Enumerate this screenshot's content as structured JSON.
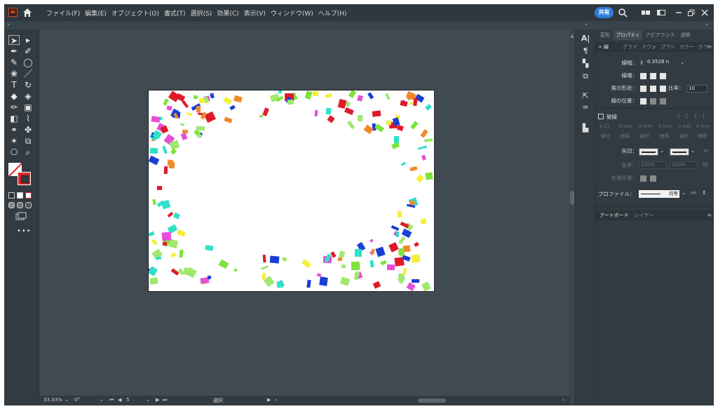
{
  "menubar": {
    "logo": "Ai",
    "items": [
      "ファイル(F)",
      "編集(E)",
      "オブジェクト(O)",
      "書式(T)",
      "選択(S)",
      "効果(C)",
      "表示(V)",
      "ウィンドウ(W)",
      "ヘルプ(H)"
    ],
    "share_label": "共有",
    "icons": [
      "home-icon",
      "search-icon",
      "arrange-icon",
      "panel-icon",
      "minimize-icon",
      "restore-icon",
      "close-icon"
    ]
  },
  "statusbar": {
    "zoom": "33.33%",
    "rotation": "0°",
    "artboard_number": "5",
    "mode": "選択"
  },
  "panel": {
    "tabs": [
      "変形",
      "プロパティ",
      "アピアランス",
      "透明"
    ],
    "active_tab": "プロパティ",
    "subtabs": [
      "線",
      "グラデ",
      "スウォ",
      "ブラシ",
      "カラー",
      "カラー"
    ],
    "stroke_weight_label": "線幅：",
    "stroke_weight_value": "0.3528 n",
    "cap_label": "線端：",
    "corner_label": "角の形状：",
    "ratio_label": "比率：",
    "ratio_value": "10",
    "align_label": "線の位置：",
    "dashed_label": "破線",
    "dash_values": [
      "4.23",
      "0 mm",
      "0 mm",
      "0 mm",
      "0 mm",
      "0 mm"
    ],
    "dash_labels": [
      "線分",
      "間隔",
      "線分",
      "間隔",
      "線分",
      "間隔"
    ],
    "arrow_label": "矢印：",
    "scale_label": "倍率：",
    "scale_value_1": "100%",
    "scale_value_2": "100%",
    "tip_label": "先端位置：",
    "profile_label": "プロファイル：",
    "profile_value": "均等",
    "lower_tabs": [
      "アートボード",
      "レイヤー"
    ]
  },
  "artboard": {
    "description_colors": [
      "#31e0c8",
      "#e44fd8",
      "#f5ee3a",
      "#7ee33a",
      "#f08a2a",
      "#1a3fd8",
      "#e01a2a",
      "#a0e870"
    ]
  }
}
